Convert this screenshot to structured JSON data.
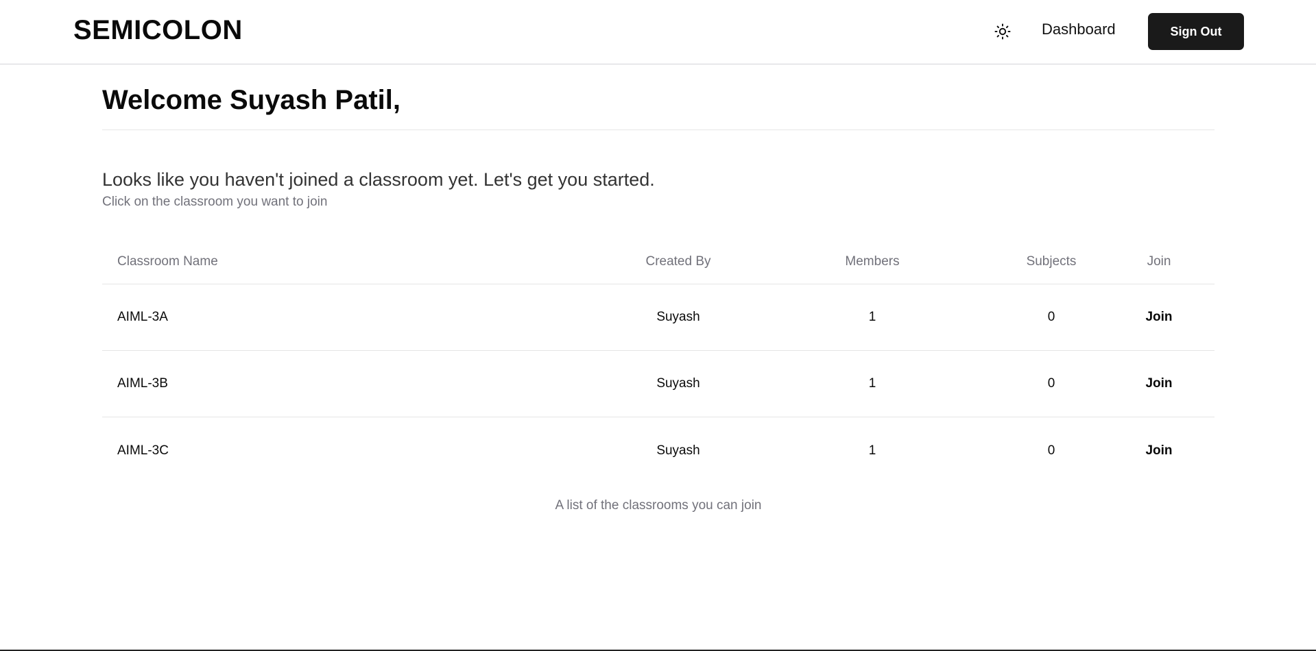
{
  "header": {
    "brand": "SEMICOLON",
    "theme_icon": "sun-icon",
    "dashboard_label": "Dashboard",
    "signout_label": "Sign Out"
  },
  "main": {
    "welcome": "Welcome Suyash Patil,",
    "subtitle": "Looks like you haven't joined a classroom yet. Let's get you started.",
    "hint": "Click on the classroom you want to join",
    "table": {
      "columns": [
        "Classroom Name",
        "Created By",
        "Members",
        "Subjects",
        "Join"
      ],
      "rows": [
        {
          "name": "AIML-3A",
          "created_by": "Suyash",
          "members": "1",
          "subjects": "0",
          "join": "Join"
        },
        {
          "name": "AIML-3B",
          "created_by": "Suyash",
          "members": "1",
          "subjects": "0",
          "join": "Join"
        },
        {
          "name": "AIML-3C",
          "created_by": "Suyash",
          "members": "1",
          "subjects": "0",
          "join": "Join"
        }
      ],
      "caption": "A list of the classrooms you can join"
    }
  },
  "colors": {
    "button_bg": "#1a1a1a",
    "muted_text": "#71717a",
    "border": "#e5e5e5"
  }
}
